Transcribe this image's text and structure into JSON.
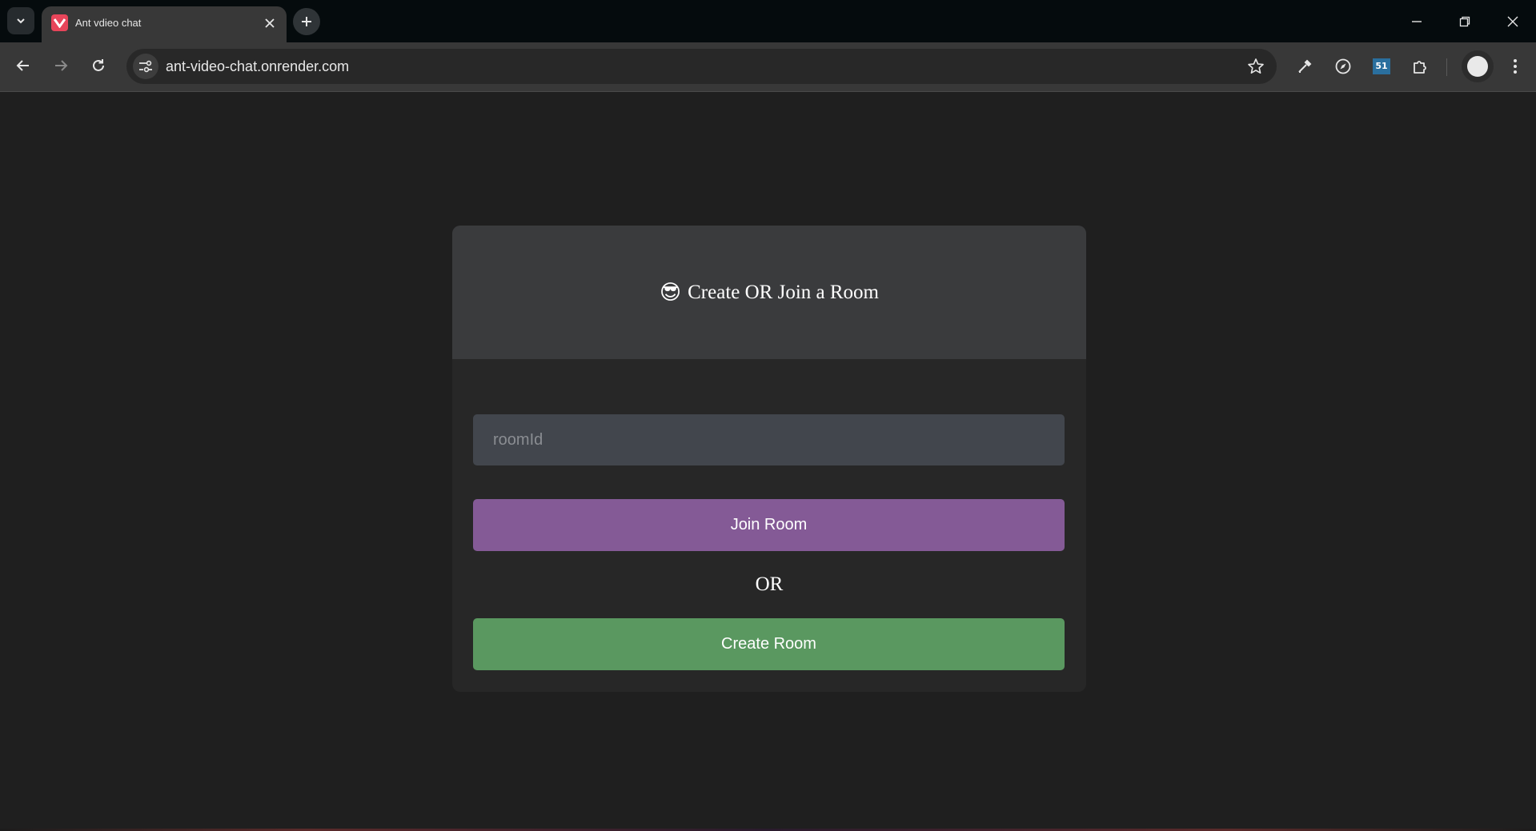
{
  "browser": {
    "tab": {
      "title": "Ant vdieo chat"
    },
    "address_bar": {
      "url": "ant-video-chat.onrender.com"
    },
    "extension_badge": "51"
  },
  "card": {
    "emoji": "😎",
    "title": "Create OR Join a Room",
    "room_input": {
      "placeholder": "roomId",
      "value": ""
    },
    "join_button_label": "Join Room",
    "or_label": "OR",
    "create_button_label": "Create Room"
  },
  "colors": {
    "join_button": "#845a96",
    "create_button": "#5a9860",
    "card_header": "#3a3b3d",
    "page_background": "#1f1f1f"
  }
}
